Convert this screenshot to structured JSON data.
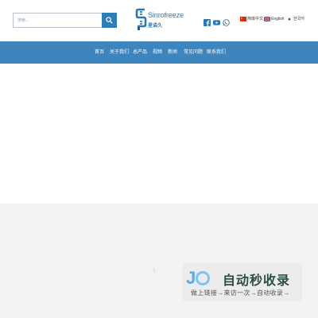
{
  "header": {
    "search": {
      "placeholder": "搜索..."
    },
    "logo": {
      "name_en": "Sinrofreeze",
      "name_cn": "星诺久"
    },
    "social": [
      {
        "icon": "facebook-icon",
        "color": "#2a78b9"
      },
      {
        "icon": "youtube-icon",
        "color": "#2a78b9"
      },
      {
        "icon": "whatsapp-icon",
        "color": "#2a78b9"
      }
    ],
    "languages": [
      {
        "label": "简体中文",
        "flag": "china-flag-icon"
      },
      {
        "label": "English",
        "flag": "uk-flag-icon"
      },
      {
        "label": "한국어",
        "flag": "korea-flag-icon"
      }
    ]
  },
  "nav": {
    "items": [
      "首页",
      "关于我们",
      "总产品",
      "视频",
      "新闻",
      "常见问题",
      "联系我们"
    ],
    "color": "#3f85bd"
  },
  "watermark": {
    "title": "自动秒收录",
    "subtitle": "做上链接→来访一次→自动收录→"
  }
}
